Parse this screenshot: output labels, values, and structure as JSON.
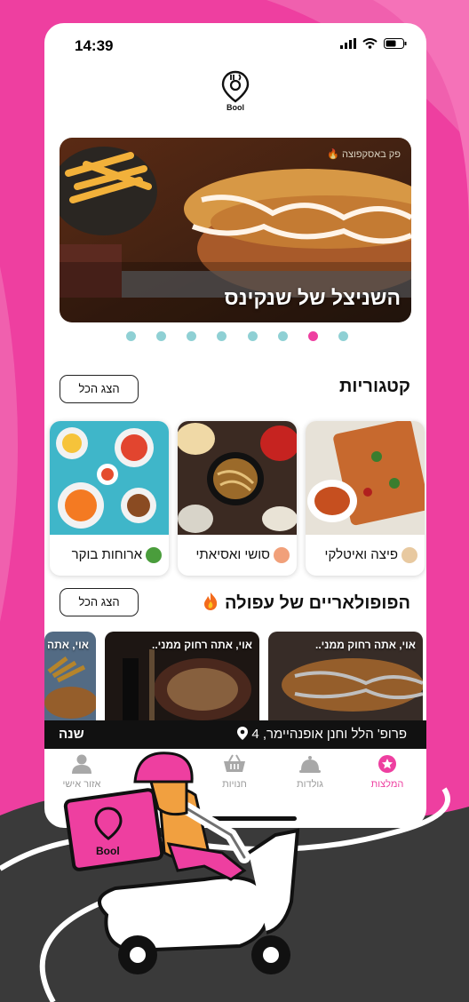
{
  "colors": {
    "brand": "#ee3fa0",
    "dot": "#8fd0d4",
    "bar": "#111111"
  },
  "status": {
    "time": "14:39",
    "icons": [
      "signal-icon",
      "wifi-icon",
      "battery-icon"
    ]
  },
  "logo": {
    "word": "Bool"
  },
  "hero": {
    "title": "השניצל של שנקינס",
    "tag": "פק באסקפוצה 🔥",
    "slides_total": 8,
    "active_slide_from_right": 2
  },
  "categories": {
    "title": "קטגוריות",
    "show_all": "הצג הכל",
    "items": [
      {
        "label": "פיצה ואיטלקי",
        "icon": "chef-icon"
      },
      {
        "label": "סושי ואסיאתי",
        "icon": "sushi-icon"
      },
      {
        "label": "ארוחות בוקר",
        "icon": "salad-icon"
      }
    ]
  },
  "popular": {
    "title": "הפופולאריים של עפולה",
    "title_icon": "fire-icon",
    "show_all": "הצג הכל",
    "items": [
      {
        "label": "אוי, אתה רחוק ממני.."
      },
      {
        "label": "אוי, אתה רחוק ממני.."
      },
      {
        "label": "אוי, אתה"
      }
    ]
  },
  "address_bar": {
    "year": "שנה",
    "address": "פרופ' הלל וחנן אופנהיימר, 4",
    "icon": "location-pin-icon"
  },
  "tabs": [
    {
      "label": "המלצות",
      "icon": "star-badge-icon",
      "active": true
    },
    {
      "label": "גולדות",
      "icon": "cloche-icon",
      "active": false
    },
    {
      "label": "חנויות",
      "icon": "basket-icon",
      "active": false
    },
    {
      "label": "אזור אישי",
      "icon": "user-icon",
      "active": false
    }
  ]
}
